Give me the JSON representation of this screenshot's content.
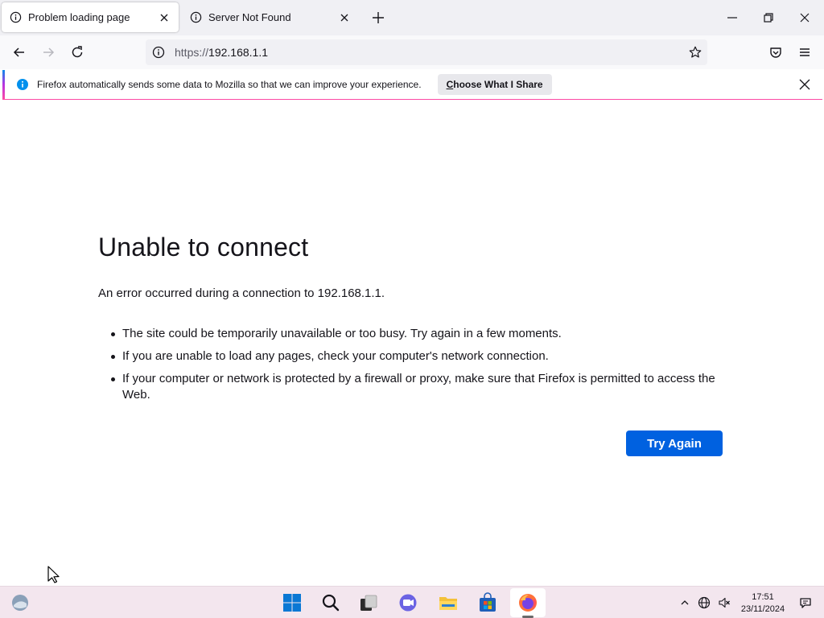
{
  "tabs": [
    {
      "title": "Problem loading page",
      "active": true
    },
    {
      "title": "Server Not Found",
      "active": false
    }
  ],
  "urlbar": {
    "scheme": "https://",
    "host": "192.168.1.1"
  },
  "notification": {
    "message": "Firefox automatically sends some data to Mozilla so that we can improve your experience.",
    "button_underlined": "C",
    "button_rest": "hoose What I Share"
  },
  "error": {
    "title": "Unable to connect",
    "description": "An error occurred during a connection to 192.168.1.1.",
    "items": [
      "The site could be temporarily unavailable or too busy. Try again in a few moments.",
      "If you are unable to load any pages, check your computer's network connection.",
      "If your computer or network is protected by a firewall or proxy, make sure that Firefox is permitted to access the Web."
    ],
    "button": "Try Again"
  },
  "clock": {
    "time": "17:51",
    "date": "23/11/2024"
  },
  "colors": {
    "accent": "#0061e0",
    "taskbar": "#f3e6ee",
    "tabstrip": "#f0f0f4"
  },
  "icons": [
    "info-icon",
    "close-icon",
    "plus-icon",
    "minimize-icon",
    "restore-icon",
    "back-arrow-icon",
    "forward-arrow-icon",
    "reload-icon",
    "star-icon",
    "pocket-icon",
    "menu-icon",
    "windows-start-icon",
    "search-icon",
    "task-view-icon",
    "chat-icon",
    "file-explorer-icon",
    "store-icon",
    "firefox-icon",
    "widgets-icon",
    "globe-icon",
    "speaker-muted-icon",
    "notification-icon"
  ]
}
